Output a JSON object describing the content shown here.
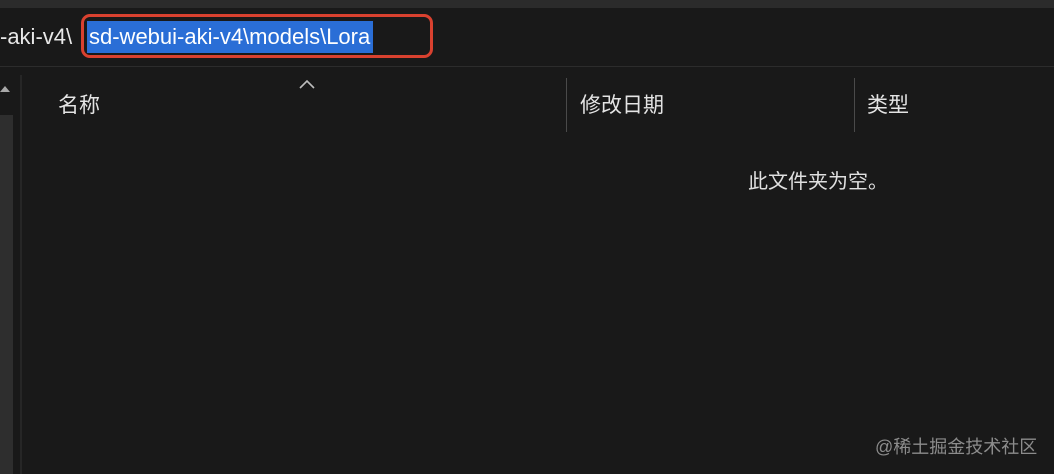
{
  "address_bar": {
    "path_prefix": "-aki-v4\\",
    "selected_path": "sd-webui-aki-v4\\models\\Lora",
    "highlight_color": "#d9412f",
    "selection_color": "#2a6ed6"
  },
  "columns": [
    {
      "label": "名称"
    },
    {
      "label": "修改日期"
    },
    {
      "label": "类型"
    }
  ],
  "sort": {
    "column": "名称",
    "direction": "ascending",
    "icon": "chevron-up-icon"
  },
  "empty_message": "此文件夹为空。",
  "watermark": "@稀土掘金技术社区",
  "theme": {
    "background": "#191919"
  }
}
